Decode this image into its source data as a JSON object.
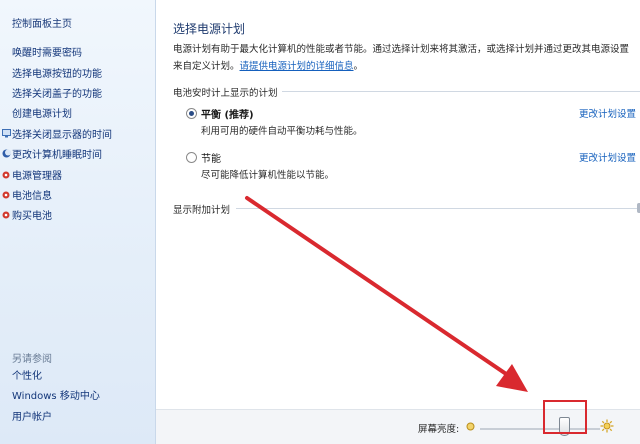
{
  "sidebar": {
    "home": "控制面板主页",
    "tasks": [
      {
        "label": "唤醒时需要密码",
        "icon": ""
      },
      {
        "label": "选择电源按钮的功能",
        "icon": ""
      },
      {
        "label": "选择关闭盖子的功能",
        "icon": ""
      },
      {
        "label": "创建电源计划",
        "icon": ""
      },
      {
        "label": "选择关闭显示器的时间",
        "icon": "monitor-icon"
      },
      {
        "label": "更改计算机睡眠时间",
        "icon": "moon-icon"
      },
      {
        "label": "电源管理器",
        "icon": "red-dot-icon"
      },
      {
        "label": "电池信息",
        "icon": "red-dot-icon"
      },
      {
        "label": "购买电池",
        "icon": "red-dot-icon"
      }
    ],
    "see_also": "另请参阅",
    "links": [
      "个性化",
      "Windows 移动中心",
      "用户帐户"
    ]
  },
  "main": {
    "title": "选择电源计划",
    "desc_prefix": "电源计划有助于最大化计算机的性能或者节能。通过选择计划来将其激活，或选择计划并通过更改其电源设置",
    "desc_suffix_start": "来自定义计划。",
    "desc_link": "请提供电源计划的详细信息",
    "desc_end": "。",
    "group_label": "电池安时计上显示的计划",
    "plans": [
      {
        "name": "平衡 (推荐)",
        "desc": "利用可用的硬件自动平衡功耗与性能。",
        "link": "更改计划设置",
        "selected": true
      },
      {
        "name": "节能",
        "desc": "尽可能降低计算机性能以节能。",
        "link": "更改计划设置",
        "selected": false
      }
    ],
    "more_label": "显示附加计划"
  },
  "bottom": {
    "brightness_label": "屏幕亮度:",
    "brightness_level_percent": 70
  },
  "colors": {
    "annotation_red": "#d9292f",
    "link_blue": "#1560bd"
  }
}
